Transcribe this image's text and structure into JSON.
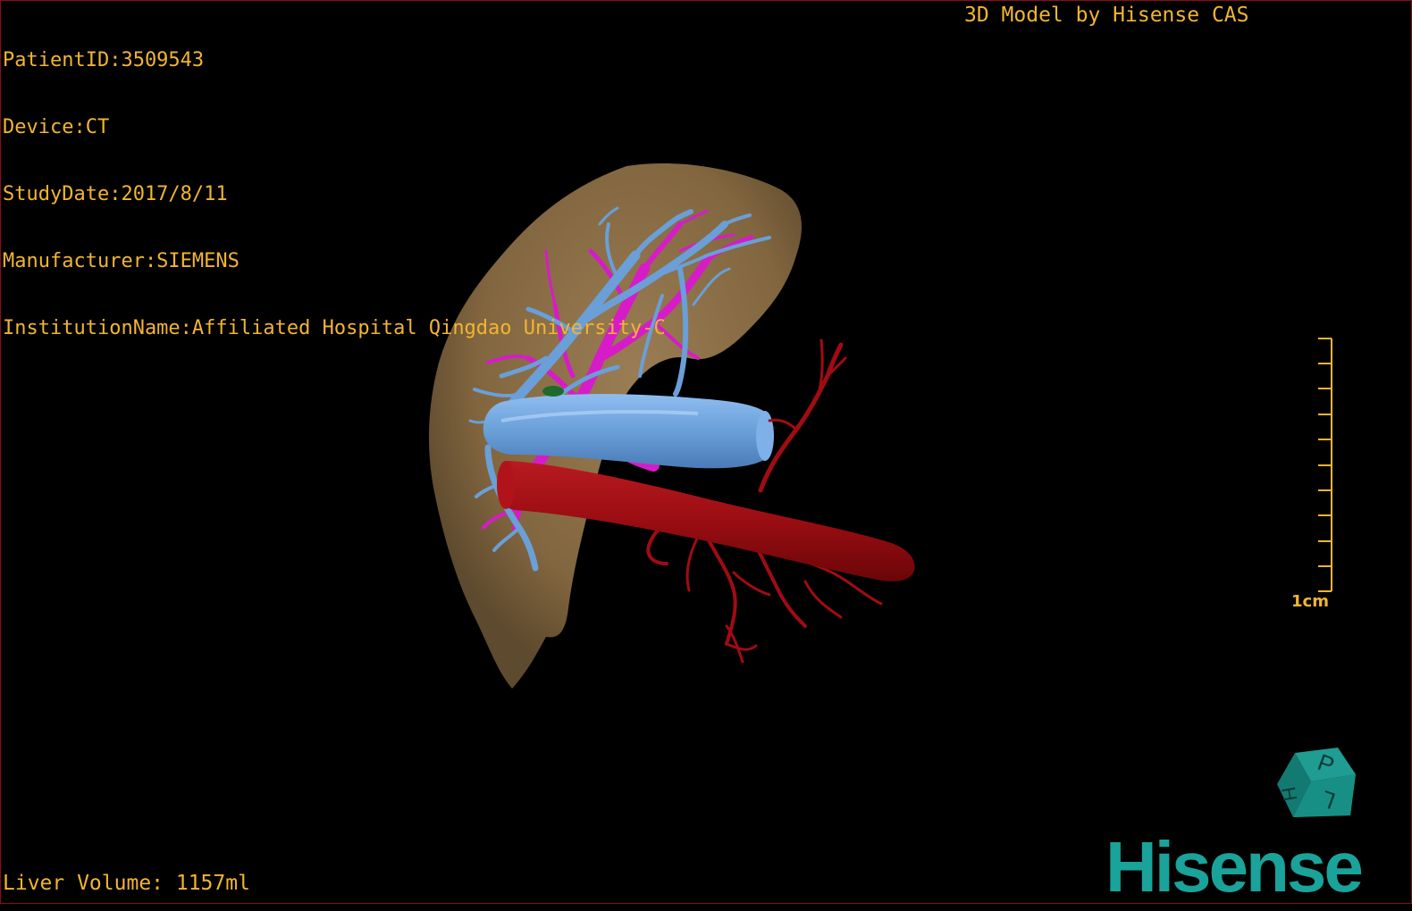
{
  "header": {
    "patient_id": "PatientID:3509543",
    "device": "Device:CT",
    "study_date": "StudyDate:2017/8/11",
    "manufacturer": "Manufacturer:SIEMENS",
    "institution": "InstitutionName:Affiliated Hospital Qingdao University-C"
  },
  "credit": "3D Model by Hisense CAS",
  "footer": {
    "liver_volume": "Liver Volume: 1157ml"
  },
  "scale": {
    "label": "1cm"
  },
  "orientation_cube": {
    "face_top": "P",
    "face_left": "H",
    "face_right": "L"
  },
  "brand": {
    "logo_text": "Hisense"
  },
  "colors": {
    "text": "#f2b531",
    "liver": "#8c704a",
    "portal_vein": "#6a9fd8",
    "hepatic_vein": "#d61cc8",
    "artery": "#a00c12",
    "brand": "#1aa39a",
    "border": "#8a0d16"
  }
}
